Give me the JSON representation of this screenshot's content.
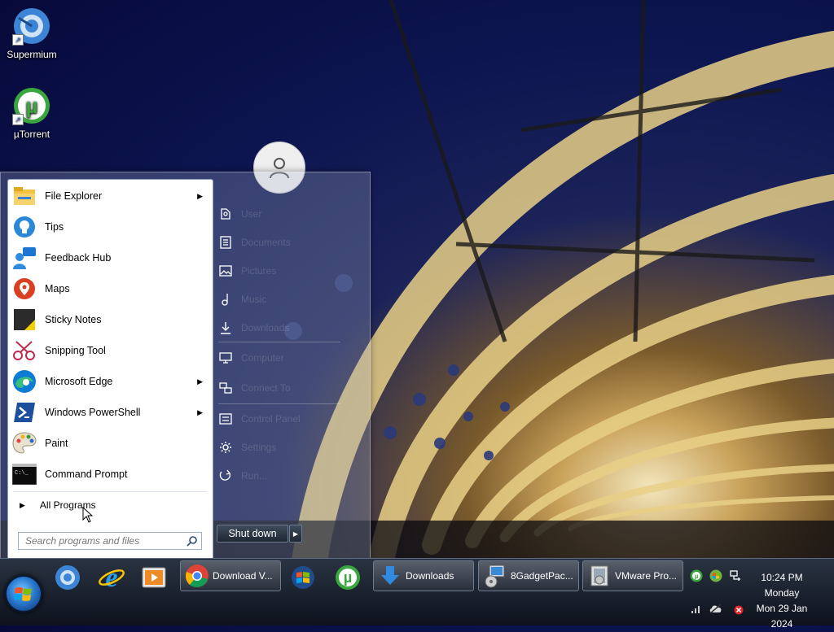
{
  "desktop": {
    "icons": [
      {
        "label": "Supermium"
      },
      {
        "label": "µTorrent"
      }
    ]
  },
  "start_menu": {
    "programs": [
      {
        "label": "File Explorer",
        "icon": "folder-icon",
        "has_submenu": true
      },
      {
        "label": "Tips",
        "icon": "lightbulb-icon",
        "has_submenu": false
      },
      {
        "label": "Feedback Hub",
        "icon": "feedback-icon",
        "has_submenu": false
      },
      {
        "label": "Maps",
        "icon": "map-pin-icon",
        "has_submenu": false
      },
      {
        "label": "Sticky Notes",
        "icon": "sticky-note-icon",
        "has_submenu": false
      },
      {
        "label": "Snipping Tool",
        "icon": "scissors-icon",
        "has_submenu": false
      },
      {
        "label": "Microsoft Edge",
        "icon": "edge-icon",
        "has_submenu": true
      },
      {
        "label": "Windows PowerShell",
        "icon": "powershell-icon",
        "has_submenu": true
      },
      {
        "label": "Paint",
        "icon": "paint-palette-icon",
        "has_submenu": false
      },
      {
        "label": "Command Prompt",
        "icon": "terminal-icon",
        "has_submenu": false
      }
    ],
    "all_programs": "All Programs",
    "search_placeholder": "Search programs and files",
    "right_items": [
      {
        "label": "User",
        "icon": "user-folder-icon"
      },
      {
        "label": "Documents",
        "icon": "document-icon"
      },
      {
        "label": "Pictures",
        "icon": "picture-icon"
      },
      {
        "label": "Music",
        "icon": "music-note-icon"
      },
      {
        "label": "Downloads",
        "icon": "download-arrow-icon"
      },
      {
        "label": "Computer",
        "icon": "monitor-icon"
      },
      {
        "label": "Connect To",
        "icon": "network-icon"
      },
      {
        "label": "Control Panel",
        "icon": "control-panel-icon"
      },
      {
        "label": "Settings",
        "icon": "gear-icon"
      },
      {
        "label": "Run...",
        "icon": "run-icon"
      }
    ],
    "shutdown_label": "Shut down"
  },
  "taskbar": {
    "pinned": [
      {
        "name": "supermium-pinned-icon"
      },
      {
        "name": "internet-explorer-pinned-icon"
      },
      {
        "name": "media-player-pinned-icon"
      }
    ],
    "tasks": [
      {
        "label": "Download V...",
        "icon": "chrome-icon"
      },
      {
        "label": "",
        "icon": "windows-flag-icon"
      },
      {
        "label": "",
        "icon": "utorrent-icon"
      },
      {
        "label": "Downloads",
        "icon": "download-arrow-icon"
      },
      {
        "label": "8GadgetPac...",
        "icon": "installer-icon"
      },
      {
        "label": "VMware Pro...",
        "icon": "vmware-icon"
      }
    ],
    "clock": {
      "time": "10:24 PM",
      "day": "Monday",
      "date": "Mon 29 Jan 2024"
    }
  }
}
